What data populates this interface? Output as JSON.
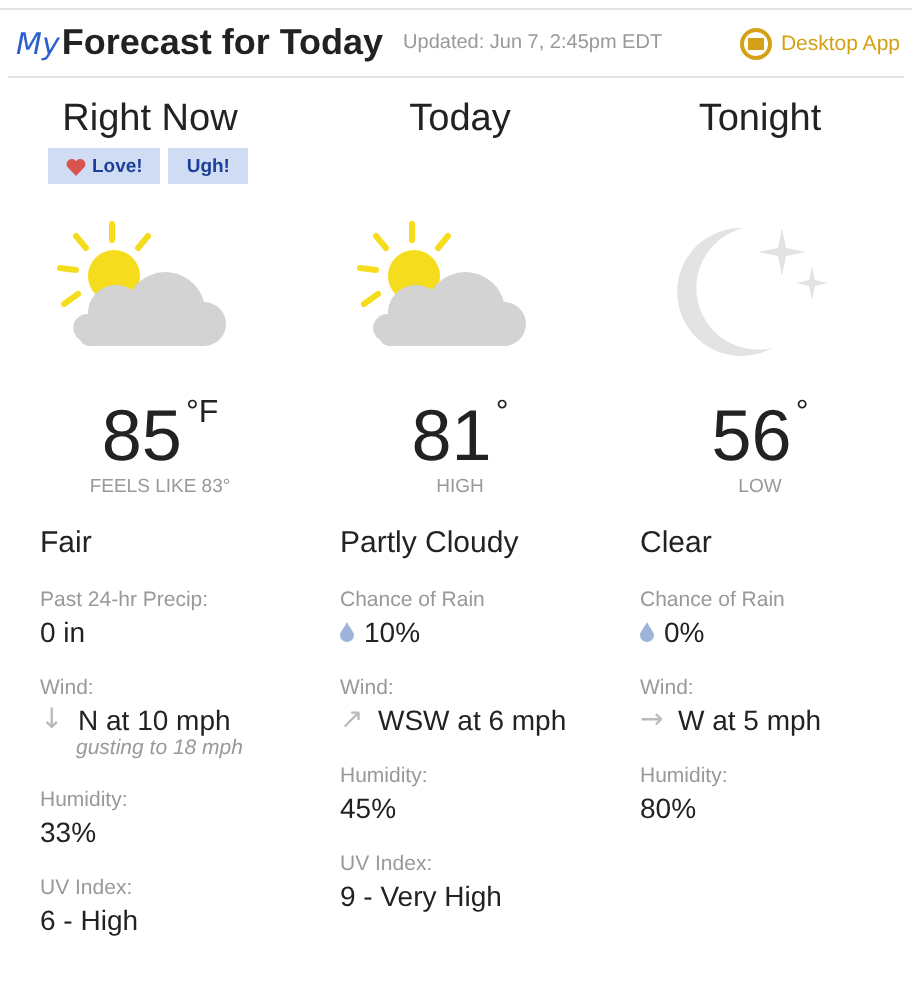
{
  "header": {
    "logo": "My",
    "title": "Forecast for Today",
    "updated": "Updated: Jun 7, 2:45pm EDT",
    "app_link": "Desktop App"
  },
  "columns": [
    {
      "title": "Right Now",
      "reactions": [
        "Love!",
        "Ugh!"
      ],
      "kind": "day",
      "temp": "85",
      "unit": "°F",
      "sublabel": "FEELS LIKE 83°",
      "condition": "Fair",
      "details": [
        {
          "kind": "plain",
          "label": "Past 24-hr Precip:",
          "value": "0 in"
        },
        {
          "kind": "wind",
          "label": "Wind:",
          "arrow": "↓",
          "value": "N at 10 mph",
          "note": "gusting to 18 mph"
        },
        {
          "kind": "plain",
          "label": "Humidity:",
          "value": "33%"
        },
        {
          "kind": "plain",
          "label": "UV Index:",
          "value": "6 - High"
        }
      ]
    },
    {
      "title": "Today",
      "kind": "day",
      "temp": "81",
      "unit": "°",
      "sublabel": "HIGH",
      "condition": "Partly Cloudy",
      "details": [
        {
          "kind": "rain",
          "label": "Chance of Rain",
          "value": "10%"
        },
        {
          "kind": "wind",
          "label": "Wind:",
          "arrow": "↗",
          "value": "WSW at 6 mph"
        },
        {
          "kind": "plain",
          "label": "Humidity:",
          "value": "45%"
        },
        {
          "kind": "plain",
          "label": "UV Index:",
          "value": "9 - Very High"
        }
      ]
    },
    {
      "title": "Tonight",
      "kind": "night",
      "temp": "56",
      "unit": "°",
      "sublabel": "LOW",
      "condition": "Clear",
      "details": [
        {
          "kind": "rain",
          "label": "Chance of Rain",
          "value": "0%"
        },
        {
          "kind": "wind",
          "label": "Wind:",
          "arrow": "→",
          "value": "W at 5 mph"
        },
        {
          "kind": "plain",
          "label": "Humidity:",
          "value": "80%"
        }
      ]
    }
  ]
}
